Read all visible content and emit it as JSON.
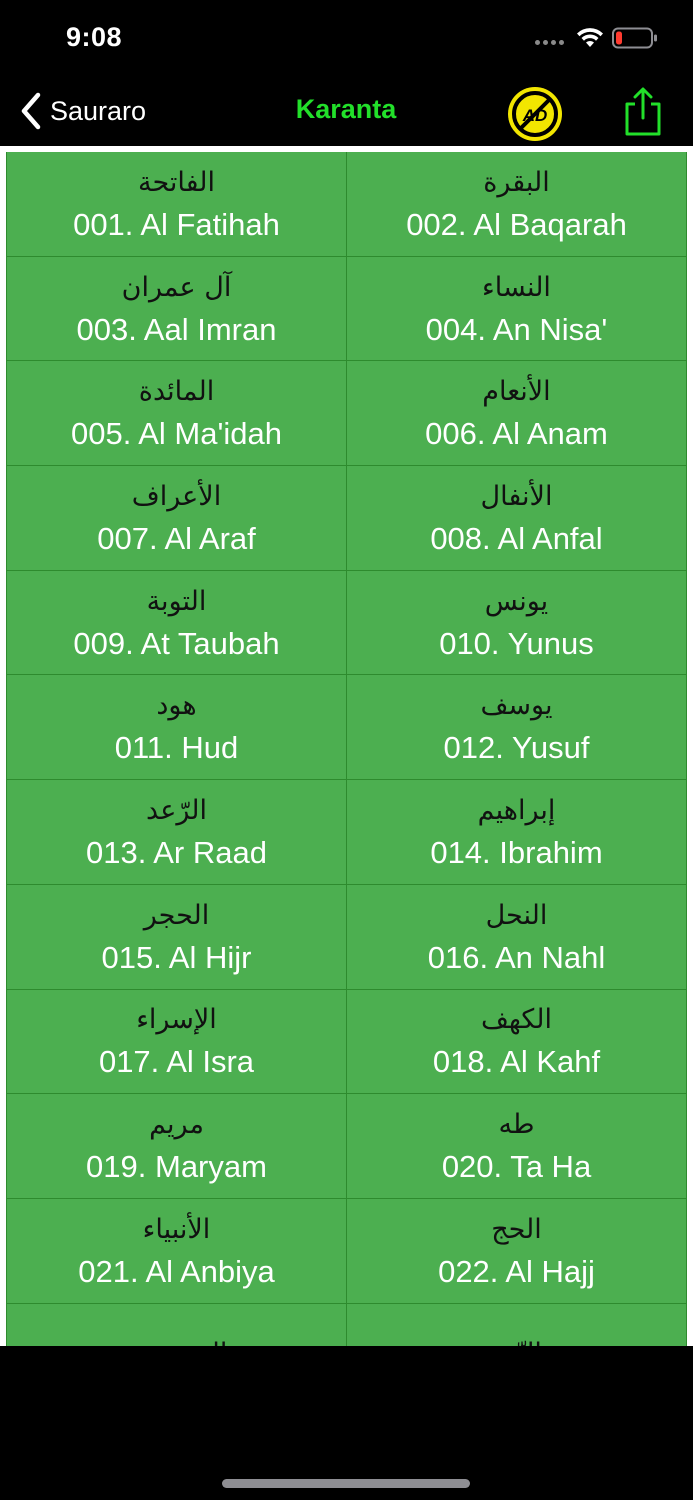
{
  "status": {
    "time": "9:08"
  },
  "nav": {
    "back_label": "Sauraro",
    "title": "Karanta",
    "ad_text": "AD"
  },
  "colors": {
    "accent": "#22e02a",
    "cell_bg": "#4caf50",
    "cell_border": "#2e8b2e",
    "ad_yellow": "#f2e600"
  },
  "surahs": [
    {
      "arabic": "الفاتحة",
      "name": "001. Al Fatihah"
    },
    {
      "arabic": "البقرة",
      "name": "002. Al Baqarah"
    },
    {
      "arabic": "آل عمران",
      "name": "003. Aal Imran"
    },
    {
      "arabic": "النساء",
      "name": "004. An Nisa'"
    },
    {
      "arabic": "المائدة",
      "name": "005. Al Ma'idah"
    },
    {
      "arabic": "الأنعام",
      "name": "006. Al Anam"
    },
    {
      "arabic": "الأعراف",
      "name": "007. Al Araf"
    },
    {
      "arabic": "الأنفال",
      "name": "008. Al Anfal"
    },
    {
      "arabic": "التوبة",
      "name": "009. At Taubah"
    },
    {
      "arabic": "يونس",
      "name": "010. Yunus"
    },
    {
      "arabic": "هود",
      "name": "011. Hud"
    },
    {
      "arabic": "يوسف",
      "name": "012. Yusuf"
    },
    {
      "arabic": "الرّعد",
      "name": "013. Ar Raad"
    },
    {
      "arabic": "إبراهيم",
      "name": "014. Ibrahim"
    },
    {
      "arabic": "الحجر",
      "name": "015. Al Hijr"
    },
    {
      "arabic": "النحل",
      "name": "016. An Nahl"
    },
    {
      "arabic": "الإسراء",
      "name": "017. Al Isra"
    },
    {
      "arabic": "الكهف",
      "name": "018. Al Kahf"
    },
    {
      "arabic": "مريم",
      "name": "019. Maryam"
    },
    {
      "arabic": "طه",
      "name": "020. Ta Ha"
    },
    {
      "arabic": "الأنبياء",
      "name": "021. Al Anbiya"
    },
    {
      "arabic": "الحج",
      "name": "022. Al Hajj"
    },
    {
      "arabic": "المؤمنون",
      "name": ""
    },
    {
      "arabic": "النّور",
      "name": ""
    }
  ]
}
